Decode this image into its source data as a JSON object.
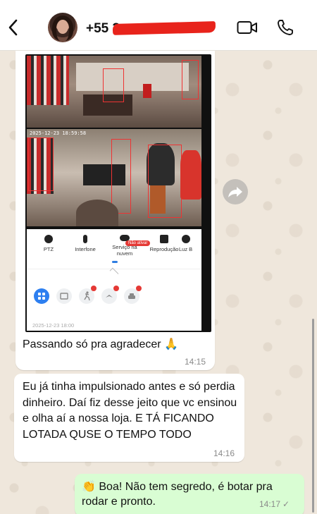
{
  "header": {
    "contact_name": "+55 3",
    "icons": {
      "back": "chevron-left-icon",
      "video": "video-camera-icon",
      "call": "phone-icon"
    }
  },
  "image_message": {
    "camera_timestamp": "2025-12-23 18:59:58",
    "panel": {
      "controls": [
        "PTZ",
        "Interfone",
        "Serviço na nuvem",
        "Reprodução",
        "Luz B"
      ],
      "cloud_badge": "Não ativar",
      "date": "2025-12-23 18:00"
    },
    "caption": "Passando só pra agradecer 🙏",
    "time": "14:15"
  },
  "messages": [
    {
      "text": "Eu já tinha impulsionado antes e só perdia dinheiro. Daí fiz desse jeito que vc ensinou e olha aí a nossa loja. E TÁ FICANDO LOTADA QUSE O TEMPO TODO",
      "time": "14:16",
      "direction": "incoming"
    },
    {
      "text": "👏 Boa! Não tem segredo, é botar pra rodar e pronto.",
      "time": "14:17",
      "status": "✓",
      "direction": "outgoing"
    }
  ],
  "colors": {
    "outgoing_bubble": "#d9fdd3",
    "incoming_bubble": "#ffffff",
    "wallpaper": "#efe7dc",
    "redaction": "#e8231b"
  }
}
